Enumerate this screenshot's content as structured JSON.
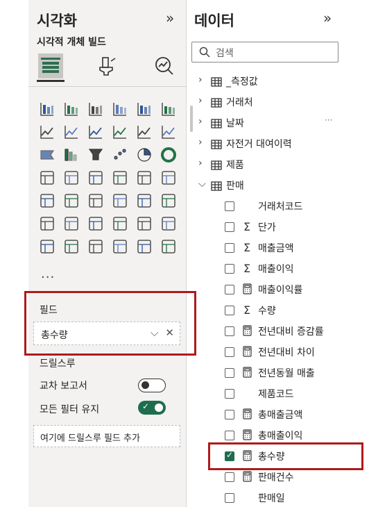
{
  "visualizations": {
    "title": "시각화",
    "collapse_glyph": "»",
    "build_label": "시각적 개체 빌드",
    "mode_icons": [
      "build-visual-icon",
      "format-visual-icon",
      "analytics-icon"
    ],
    "visual_icons": [
      "stacked-bar-chart-icon",
      "stacked-column-chart-icon",
      "clustered-bar-chart-icon",
      "clustered-column-chart-icon",
      "100-stacked-bar-chart-icon",
      "100-stacked-column-chart-icon",
      "line-chart-icon",
      "area-chart-icon",
      "stacked-area-chart-icon",
      "100-stacked-area-chart-icon",
      "line-and-stacked-column-chart-icon",
      "line-and-clustered-column-chart-icon",
      "ribbon-chart-icon",
      "waterfall-chart-icon",
      "funnel-chart-icon",
      "scatter-chart-icon",
      "pie-chart-icon",
      "donut-chart-icon",
      "treemap-icon",
      "map-icon",
      "filled-map-icon",
      "azure-map-icon",
      "gauge-icon",
      "card-icon",
      "multi-row-card-icon",
      "kpi-icon",
      "slicer-icon",
      "table-icon",
      "matrix-icon",
      "r-visual-icon",
      "python-visual-icon",
      "key-influencers-icon",
      "decomposition-tree-icon",
      "qa-icon",
      "smart-narrative-icon",
      "metrics-icon",
      "paginated-report-icon",
      "power-apps-icon",
      "power-automate-icon",
      "arcgis-map-icon",
      "power-bi-visual-icon",
      "get-more-visuals-icon"
    ],
    "more_label": "...",
    "fields_label": "필드",
    "field_value": "총수량",
    "drill_title": "드릴스루",
    "cross_report_label": "교차 보고서",
    "cross_report_state": "off",
    "keep_filters_label": "모든 필터 유지",
    "keep_filters_state": "on",
    "drill_placeholder": "여기에 드릴스루 필드 추가"
  },
  "data": {
    "title": "데이터",
    "collapse_glyph": "»",
    "search_placeholder": "검색",
    "more_glyph": "···",
    "tables": [
      {
        "name": "_측정값",
        "expanded": false
      },
      {
        "name": "거래처",
        "expanded": false
      },
      {
        "name": "날짜",
        "expanded": false
      },
      {
        "name": "자전거 대여이력",
        "expanded": false
      },
      {
        "name": "제품",
        "expanded": false
      },
      {
        "name": "판매",
        "expanded": true
      }
    ],
    "fields": [
      {
        "name": "거래처코드",
        "type": "none",
        "checked": false
      },
      {
        "name": "단가",
        "type": "sigma",
        "checked": false
      },
      {
        "name": "매출금액",
        "type": "sigma",
        "checked": false
      },
      {
        "name": "매출이익",
        "type": "sigma",
        "checked": false
      },
      {
        "name": "매출이익률",
        "type": "calculator",
        "checked": false
      },
      {
        "name": "수량",
        "type": "sigma",
        "checked": false
      },
      {
        "name": "전년대비 증감률",
        "type": "calculator",
        "checked": false
      },
      {
        "name": "전년대비 차이",
        "type": "calculator",
        "checked": false
      },
      {
        "name": "전년동월 매출",
        "type": "calculator",
        "checked": false
      },
      {
        "name": "제품코드",
        "type": "none",
        "checked": false
      },
      {
        "name": "총매출금액",
        "type": "calculator",
        "checked": false
      },
      {
        "name": "총매출이익",
        "type": "calculator",
        "checked": false
      },
      {
        "name": "총수량",
        "type": "calculator",
        "checked": true
      },
      {
        "name": "판매건수",
        "type": "calculator",
        "checked": false
      },
      {
        "name": "판매일",
        "type": "none",
        "checked": false
      }
    ]
  },
  "colors": {
    "accent_green": "#1e6e4e",
    "highlight_red": "#b0191b"
  }
}
